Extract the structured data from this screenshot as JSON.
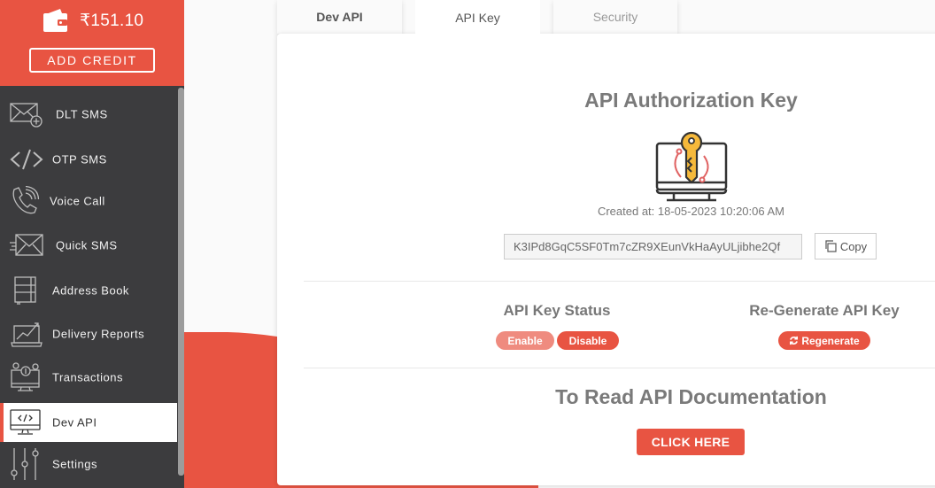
{
  "sidebar": {
    "balance": "₹151.10",
    "add_credit_label": "ADD CREDIT",
    "items": [
      {
        "label": "DLT SMS",
        "icon": "envelope-plus-icon"
      },
      {
        "label": "OTP SMS",
        "icon": "code-icon"
      },
      {
        "label": "Voice Call",
        "icon": "phone-ringing-icon"
      },
      {
        "label": "Quick SMS",
        "icon": "fast-envelope-icon"
      },
      {
        "label": "Address Book",
        "icon": "notebook-icon"
      },
      {
        "label": "Delivery Reports",
        "icon": "laptop-chart-icon"
      },
      {
        "label": "Transactions",
        "icon": "monitor-coins-icon"
      },
      {
        "label": "Dev API",
        "icon": "monitor-code-icon",
        "active": true
      },
      {
        "label": "Settings",
        "icon": "sliders-icon"
      }
    ]
  },
  "tabs": [
    {
      "label": "Dev API"
    },
    {
      "label": "API Key",
      "active": true
    },
    {
      "label": "Security"
    }
  ],
  "main": {
    "title": "API Authorization Key",
    "created_at": "Created at: 18-05-2023 10:20:06 AM",
    "api_key": "K3IPd8GqC5SF0Tm7cZR9XEunVkHaAyULjibhe2Qf",
    "copy_label": "Copy",
    "status_title": "API Key Status",
    "enable_label": "Enable",
    "disable_label": "Disable",
    "regen_title": "Re-Generate API Key",
    "regen_label": "Regenerate",
    "doc_title": "To Read API Documentation",
    "doc_button_label": "CLICK HERE"
  },
  "colors": {
    "accent": "#e85442",
    "accent_light": "#ef8b7f",
    "sidebar_bg": "#3c3c3e",
    "key_yellow": "#f6b93b"
  }
}
